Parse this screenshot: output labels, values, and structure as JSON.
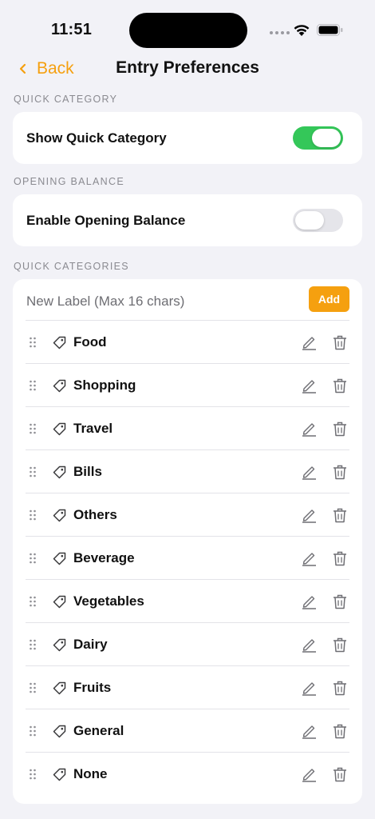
{
  "status_bar": {
    "time": "11:51"
  },
  "nav": {
    "back_label": "Back",
    "title": "Entry Preferences"
  },
  "sections": {
    "quick_category": {
      "header": "QUICK CATEGORY",
      "row_label": "Show Quick Category",
      "toggle_on": true
    },
    "opening_balance": {
      "header": "OPENING BALANCE",
      "row_label": "Enable Opening Balance",
      "toggle_on": false
    },
    "quick_categories": {
      "header": "QUICK CATEGORIES",
      "new_label_placeholder": "New Label (Max 16 chars)",
      "add_label": "Add",
      "items": [
        "Food",
        "Shopping",
        "Travel",
        "Bills",
        "Others",
        "Beverage",
        "Vegetables",
        "Dairy",
        "Fruits",
        "General",
        "None"
      ]
    }
  },
  "colors": {
    "accent": "#f5a00f",
    "toggle_on": "#34c759",
    "toggle_off": "#e5e5ea",
    "background": "#f2f2f7"
  },
  "icons": [
    "drag-handle-icon",
    "tag-icon",
    "edit-pencil-icon",
    "trash-icon",
    "chevron-left-icon",
    "wifi-icon",
    "battery-icon"
  ]
}
